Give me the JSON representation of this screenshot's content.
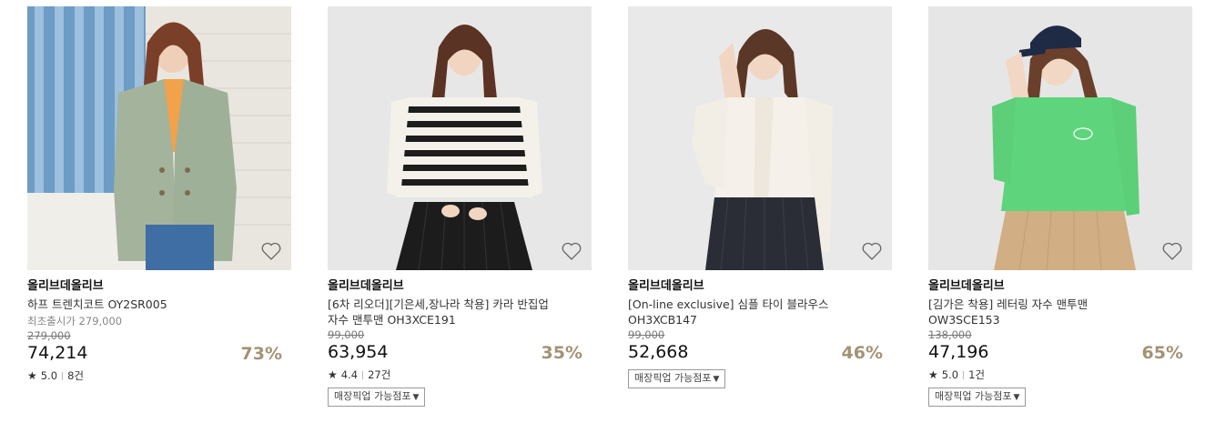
{
  "products": [
    {
      "brand": "올리브데올리브",
      "title": "하프 트렌치코트 OY2SR005",
      "first_price": "최초출시가 279,000",
      "original_price": "279,000",
      "price": "74,214",
      "discount": "73%",
      "rating": "5.0",
      "reviews": "8건",
      "pickup": "",
      "image_bg": "#dfe3e6"
    },
    {
      "brand": "올리브데올리브",
      "title": "[6차 리오더][기은세,장나라 착용] 카라 반집업\n자수 맨투맨 OH3XCE191",
      "first_price": "",
      "original_price": "99,000",
      "price": "63,954",
      "discount": "35%",
      "rating": "4.4",
      "reviews": "27건",
      "pickup": "매장픽업 가능점포",
      "image_bg": "#e7e7e7"
    },
    {
      "brand": "올리브데올리브",
      "title": "[On-line exclusive] 심플 타이 블라우스\nOH3XCB147",
      "first_price": "",
      "original_price": "99,000",
      "price": "52,668",
      "discount": "46%",
      "rating": "",
      "reviews": "",
      "pickup": "매장픽업 가능점포",
      "image_bg": "#e8e8e8"
    },
    {
      "brand": "올리브데올리브",
      "title": "[김가은 착용] 레터링 자수 맨투맨\nOW3SCE153",
      "first_price": "",
      "original_price": "138,000",
      "price": "47,196",
      "discount": "65%",
      "rating": "5.0",
      "reviews": "1건",
      "pickup": "매장픽업 가능점포",
      "image_bg": "#e6e6e6"
    }
  ],
  "icons": {
    "wishlist": "heart-outline-icon",
    "rating": "star-icon",
    "dropdown": "triangle-down-icon"
  },
  "colors": {
    "discount": "#a39374",
    "text": "#222222"
  }
}
